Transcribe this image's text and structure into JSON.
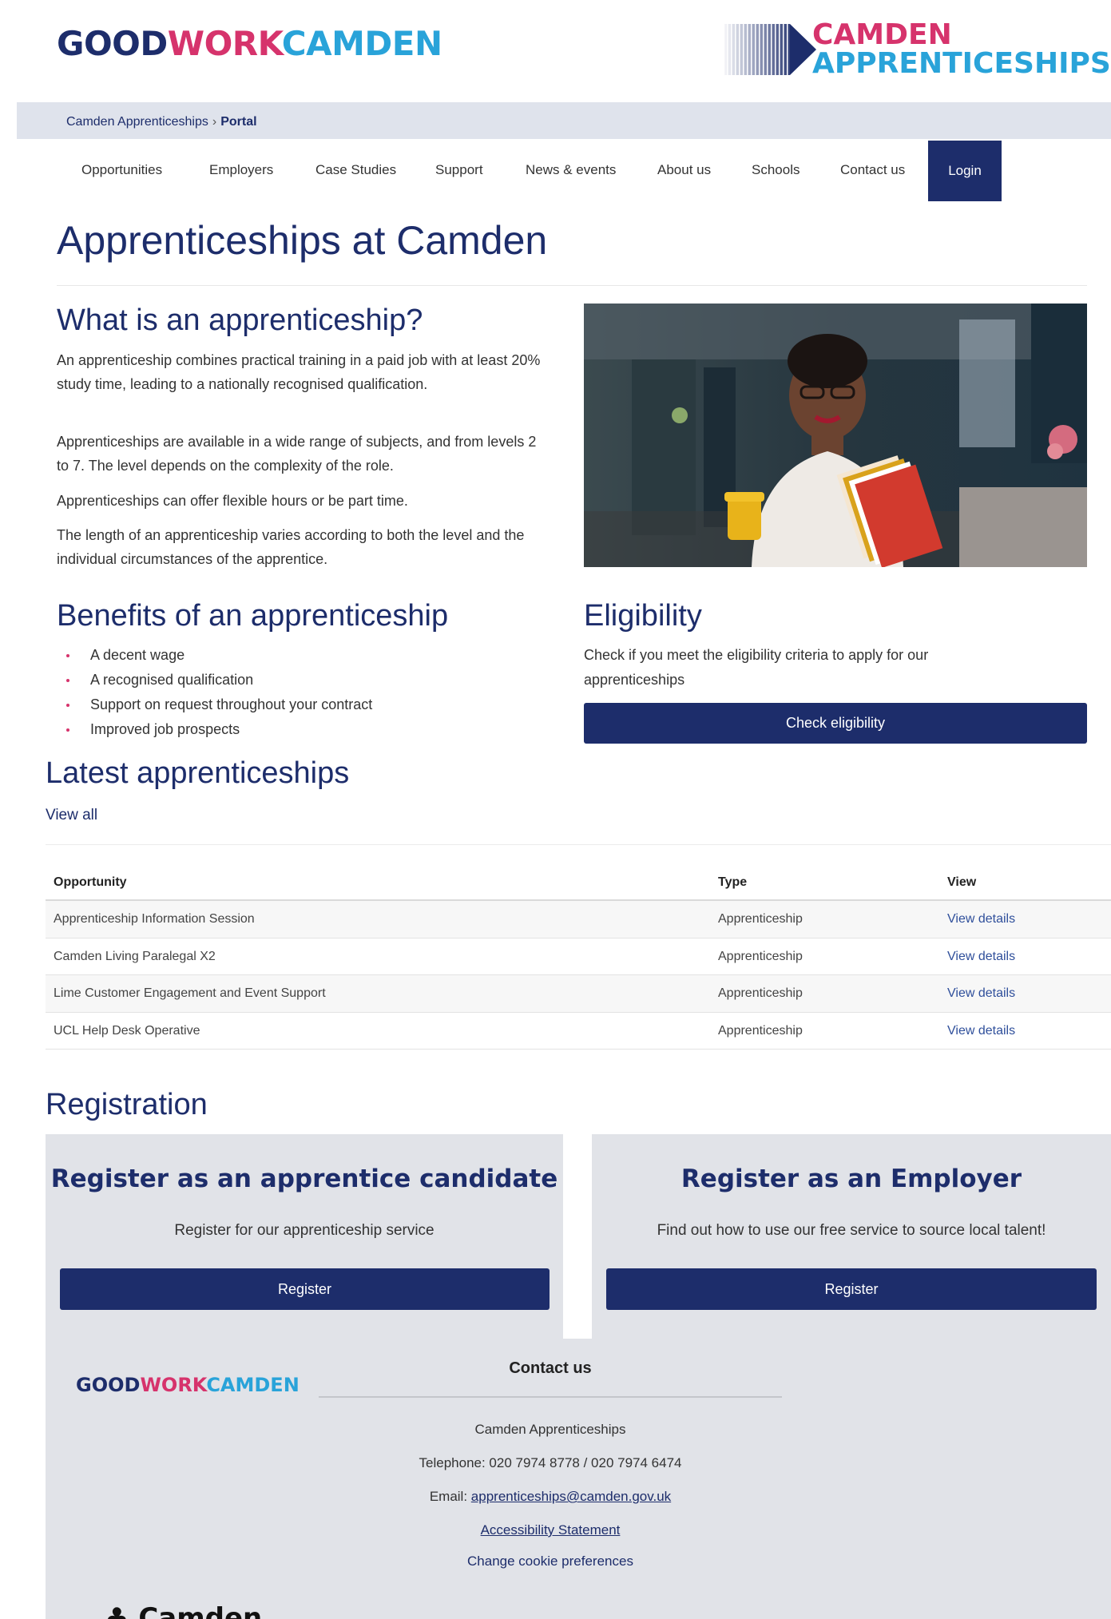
{
  "header": {
    "logo_left": {
      "part1": "GOOD",
      "part2": "WORK",
      "part3": "CAMDEN"
    },
    "logo_right": {
      "line1": "CAMDEN",
      "line2": "APPRENTICESHIPS"
    }
  },
  "breadcrumb": {
    "parent": "Camden Apprenticeships",
    "separator": "›",
    "current": "Portal"
  },
  "nav": {
    "items": [
      "Opportunities",
      "Employers",
      "Case Studies",
      "Support",
      "News & events",
      "About us",
      "Schools",
      "Contact us"
    ],
    "login": "Login"
  },
  "page": {
    "title": "Apprenticeships at Camden"
  },
  "what_is": {
    "heading": "What is an apprenticeship?",
    "paragraphs": [
      "An apprenticeship combines practical training in a paid job with at least 20% study time, leading to a nationally recognised qualification.",
      "Apprenticeships are available in a wide range of subjects, and from levels 2 to 7. The level depends on the complexity of the role.",
      "Apprenticeships can offer flexible hours or be part time.",
      "The length of an apprenticeship varies according to both the level and the individual circumstances of the apprentice."
    ]
  },
  "benefits": {
    "heading": "Benefits of an apprenticeship",
    "items": [
      "A decent wage",
      "A recognised qualification",
      "Support on request throughout your contract",
      "Improved job prospects"
    ]
  },
  "eligibility": {
    "heading": "Eligibility",
    "text": "Check if you meet the eligibility criteria to apply for our apprenticeships",
    "button": "Check eligibility"
  },
  "latest": {
    "heading": "Latest apprenticeships",
    "view_all": "View all",
    "columns": [
      "Opportunity",
      "Type",
      "View"
    ],
    "rows": [
      {
        "opportunity": "Apprenticeship Information Session",
        "type": "Apprenticeship",
        "view": "View details"
      },
      {
        "opportunity": "Camden Living Paralegal X2",
        "type": "Apprenticeship",
        "view": "View details"
      },
      {
        "opportunity": "Lime Customer Engagement and Event Support",
        "type": "Apprenticeship",
        "view": "View details"
      },
      {
        "opportunity": "UCL Help Desk Operative",
        "type": "Apprenticeship",
        "view": "View details"
      }
    ]
  },
  "registration": {
    "heading": "Registration",
    "candidate": {
      "title": "Register as an apprentice candidate",
      "subtitle": "Register for our apprenticeship service",
      "button": "Register"
    },
    "employer": {
      "title": "Register as an Employer",
      "subtitle": "Find out how to use our free service to source local talent!",
      "button": "Register"
    }
  },
  "footer": {
    "heading": "Contact us",
    "org": "Camden Apprenticeships",
    "telephone": "Telephone: 020 7974 8778 / 020 7974 6474",
    "email_label": "Email: ",
    "email": "apprenticeships@camden.gov.uk",
    "accessibility": "Accessibility Statement",
    "cookies": "Change cookie preferences",
    "camden_logo": "Camden"
  },
  "colors": {
    "brand_navy": "#1d2d6b",
    "brand_pink": "#d6336c",
    "brand_blue": "#29a3d9",
    "panel_grey": "#e1e3e8"
  }
}
